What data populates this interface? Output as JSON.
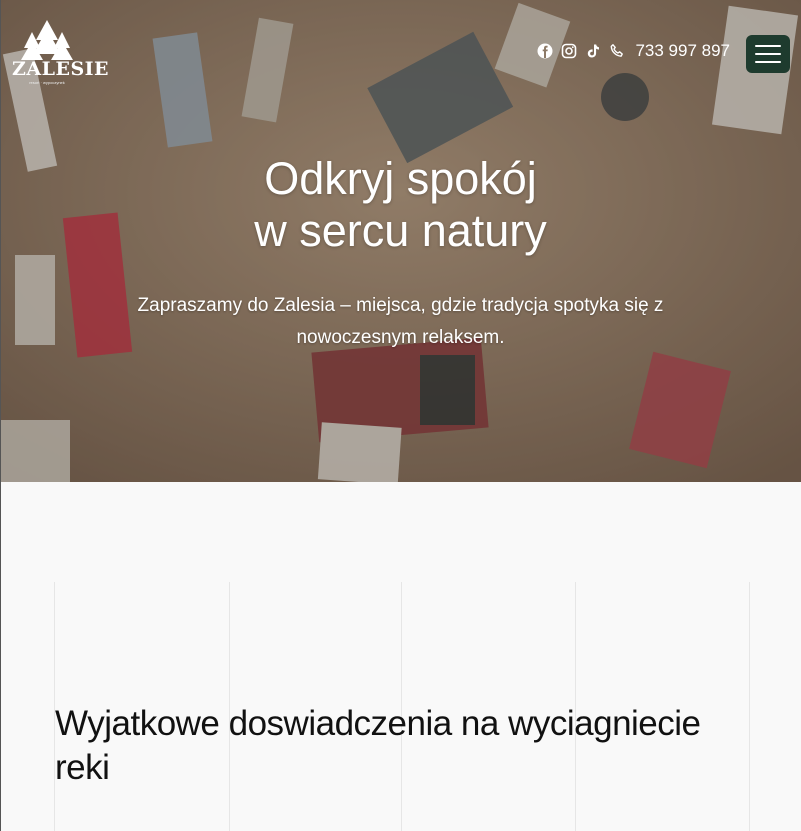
{
  "brand": {
    "name": "ZALESIE",
    "tagline": "resort · wypoczynek"
  },
  "header": {
    "social_icons": [
      "facebook-icon",
      "instagram-icon",
      "tiktok-icon"
    ],
    "phone_icon": "phone-icon",
    "phone": "733 997 897",
    "menu_icon": "hamburger-icon"
  },
  "hero": {
    "title_line1": "Odkryj spokój",
    "title_line2": "w sercu natury",
    "subtitle": "Zapraszamy do Zalesia – miejsca, gdzie tradycja spotyka się z nowoczesnym relaksem."
  },
  "section": {
    "title": "Wyjatkowe doswiadczenia na wyciagniecie reki"
  },
  "colors": {
    "menu_button": "#1e3b2e",
    "hero_overlay": "#a9937c",
    "page_background": "#f9f9f9"
  }
}
